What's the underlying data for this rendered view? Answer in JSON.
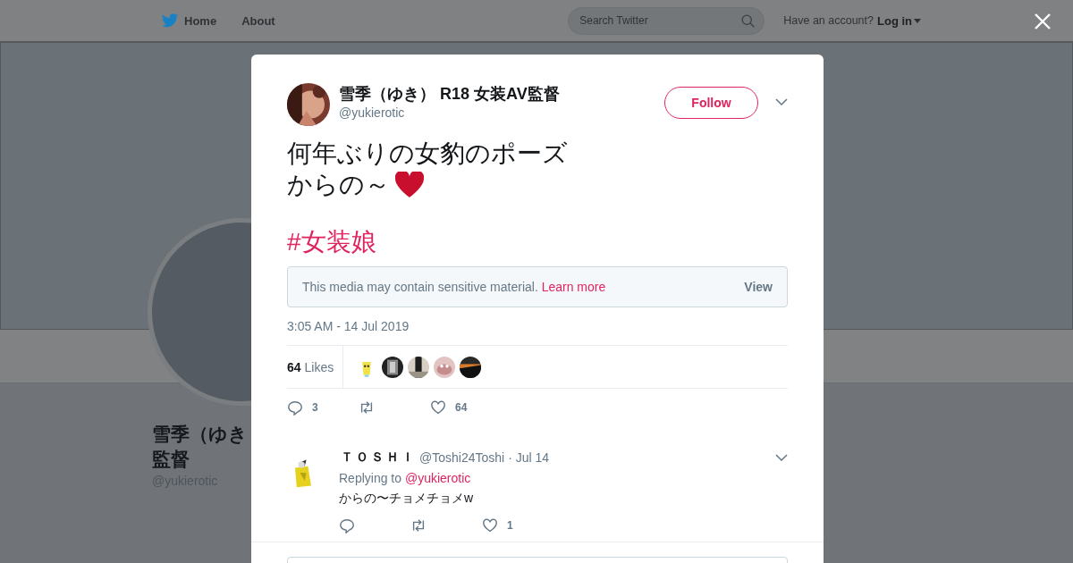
{
  "nav": {
    "items": [
      {
        "label": "Home"
      },
      {
        "label": "About"
      }
    ],
    "search": {
      "placeholder": "Search Twitter"
    },
    "account_prompt": "Have an account?",
    "login": "Log in"
  },
  "profile": {
    "name_lines": [
      "雪季（ゆき",
      "監督"
    ],
    "handle": "@yukierotic"
  },
  "tweet": {
    "name": "雪季（ゆき） R18 女装AV監督",
    "handle": "@yukierotic",
    "follow": "Follow",
    "text_lines": [
      "何年ぶりの女豹のポーズ",
      "からの～"
    ],
    "hashtag": "#女装娘",
    "sensitive": {
      "text": "This media may contain sensitive material.",
      "link": "Learn more",
      "action": "View"
    },
    "timestamp": "3:05 AM - 14 Jul 2019",
    "likes": {
      "count": "64",
      "label": "Likes"
    },
    "actions": [
      {
        "kind": "reply",
        "count": "3"
      },
      {
        "kind": "retweet"
      },
      {
        "kind": "like",
        "count": "64"
      }
    ]
  },
  "replies": [
    {
      "name": "ＴＯＳＨＩ",
      "handle": "@Toshi24Toshi",
      "date": "· Jul 14",
      "replying_to": "Replying to",
      "mention": "@yukierotic",
      "text": "からの〜チョメチョメw",
      "actions": [
        {
          "kind": "reply"
        },
        {
          "kind": "retweet"
        },
        {
          "kind": "like",
          "count": "1"
        }
      ]
    }
  ]
}
